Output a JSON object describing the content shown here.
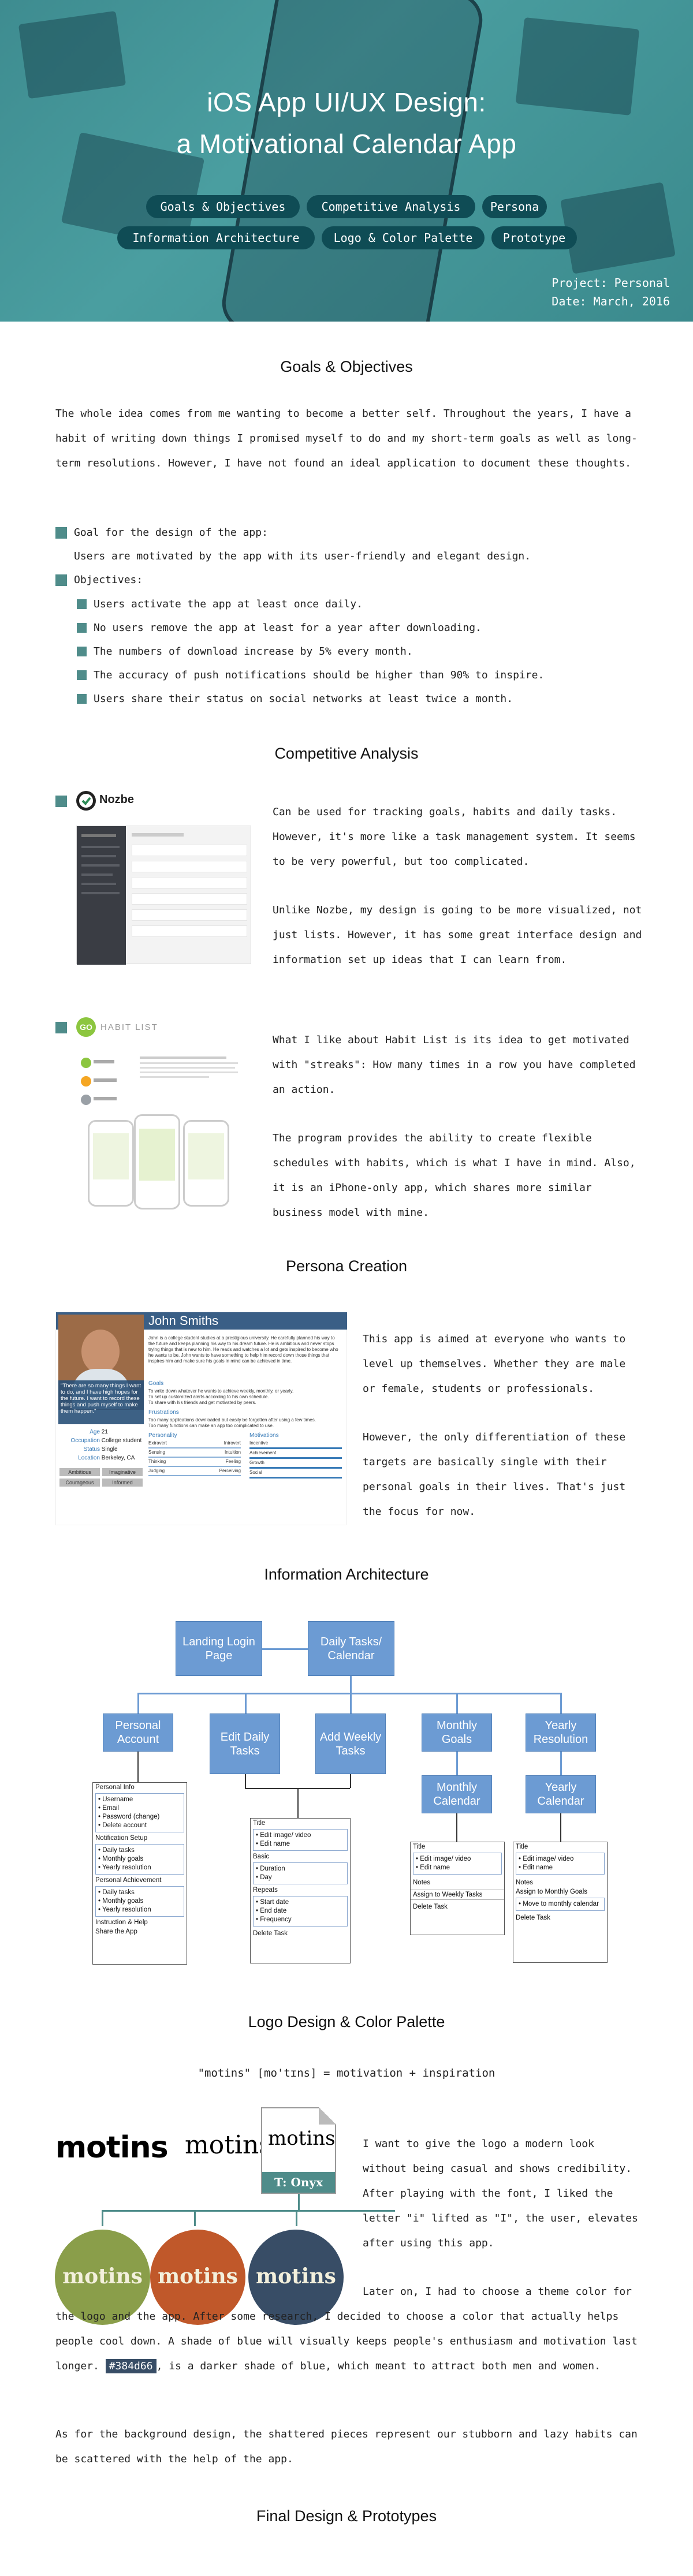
{
  "hero": {
    "title_line1": "iOS App UI/UX Design:",
    "title_line2": "a Motivational Calendar App",
    "nav": [
      "Goals & Objectives",
      "Competitive Analysis",
      "Persona",
      "Information Architecture",
      "Logo & Color Palette",
      "Prototype"
    ],
    "project": "Project: Personal",
    "date": "Date: March, 2016"
  },
  "goals": {
    "title": "Goals & Objectives",
    "intro": "The whole idea comes from me wanting to become a better self. Throughout the years, I have a habit of writing down things I promised myself to do and my short-term goals as well as long-term resolutions. However, I have not found an ideal application to document these thoughts.",
    "goal_heading": "Goal for the design of the app:",
    "goal_text": "Users are motivated by the app with its user-friendly and elegant design.",
    "objectives_heading": "Objectives:",
    "objectives": [
      "Users activate the app at least once daily.",
      "No users remove the app at least for a year after downloading.",
      "The numbers of download increase by 5% every month.",
      "The accuracy of push notifications should be higher than 90% to inspire.",
      "Users share their status on social networks at least twice a month."
    ]
  },
  "competitive": {
    "title": "Competitive Analysis",
    "nozbe_name": "Nozbe",
    "nozbe_p1": "Can be used for tracking goals, habits and daily tasks. However, it's more like a task management system. It seems to be very powerful, but too complicated.",
    "nozbe_p2": "Unlike Nozbe, my design is going to be more visualized, not just lists. However, it has some great interface design and information set up ideas that I can learn from.",
    "habit_badge": "GO",
    "habit_name": "HABIT LIST",
    "habit_p1": "What I like about Habit List is its idea to get motivated with \"streaks\": How many times in a row you have completed an action.",
    "habit_p2": "The program provides the ability to create flexible schedules with habits, which is what I have in mind. Also, it is an iPhone-only app, which shares more similar business model with mine."
  },
  "persona": {
    "title": "Persona Creation",
    "name": "John Smiths",
    "quote": "\"There are so many things I want to do, and I have high hopes for the future. I want to record these things and push myself to make them happen.\"",
    "bio": "John is a college student studies at a prestigious university. He carefully planned his way to the future and keeps planning his way to his dream future. He is ambitious and never stops trying things that is new to him. He reads and watches a lot and gets inspired to become who he wants to be. John wants to have something to help him record down those things that inspires him and make sure his goals in mind can be achieved in time.",
    "goals_label": "Goals",
    "goals_items": [
      "To write down whatever he wants to achieve weekly, monthly, or yearly.",
      "To set up customized alerts according to his own schedule.",
      "To share with his friends and get motivated by peers."
    ],
    "frustrations_label": "Frustrations",
    "frustrations_items": [
      "Too many applications downloaded but easily be forgotten after using a few times.",
      "Too many functions can make an app too complicated to use."
    ],
    "fields": [
      {
        "k": "Age",
        "v": "21"
      },
      {
        "k": "Occupation",
        "v": "College student"
      },
      {
        "k": "Status",
        "v": "Single"
      },
      {
        "k": "Location",
        "v": "Berkeley, CA"
      }
    ],
    "tags": [
      "Ambitious",
      "Imaginative",
      "Courageous",
      "Informed"
    ],
    "personality_label": "Personality",
    "personality_rows": [
      [
        "Extravert",
        "Introvert"
      ],
      [
        "Sensing",
        "Intuition"
      ],
      [
        "Thinking",
        "Feeling"
      ],
      [
        "Judging",
        "Perceiving"
      ]
    ],
    "motivations_label": "Motivations",
    "motivations_rows": [
      "Incentive",
      "Achievement",
      "Growth",
      "Social"
    ],
    "p1": "This app is aimed at everyone who wants to level up themselves. Whether they are male or female, students or professionals.",
    "p2": "However, the only differentiation of these targets are basically single with their personal goals in their lives. That's just the focus for now."
  },
  "ia": {
    "title": "Information Architecture",
    "landing": "Landing Login Page",
    "daily_cal": "Daily Tasks/ Calendar",
    "personal": "Personal Account",
    "edit_daily": "Edit Daily Tasks",
    "add_weekly": "Add Weekly Tasks",
    "monthly_goals": "Monthly Goals",
    "yearly_res": "Yearly Resolution",
    "monthly_cal": "Monthly Calendar",
    "yearly_cal": "Yearly Calendar",
    "personal_info": "Personal Info",
    "personal_info_items": [
      "Username",
      "Email",
      "Password (change)",
      "Delete account"
    ],
    "notif": "Notification Setup",
    "notif_items": [
      "Daily tasks",
      "Monthly goals",
      "Yearly resolution"
    ],
    "achievement": "Personal Achievement",
    "achievement_items": [
      "Daily tasks",
      "Monthly goals",
      "Yearly resolution"
    ],
    "instruction": "Instruction & Help",
    "share": "Share the App",
    "title_label": "Title",
    "title_items": [
      "Edit image/ video",
      "Edit name"
    ],
    "basic": "Basic",
    "basic_items": [
      "Duration",
      "Day"
    ],
    "repeats": "Repeats",
    "repeats_items": [
      "Start date",
      "End date",
      "Frequency"
    ],
    "delete_task": "Delete Task",
    "notes": "Notes",
    "assign_weekly": "Assign to Weekly Tasks",
    "assign_monthly": "Assign to Monthly Goals",
    "move_monthly": "Move to monthly calendar"
  },
  "logo": {
    "title": "Logo Design & Color Palette",
    "etym": "\"motins\" [mo'tɪns] = motivation + inspiration",
    "wordmark": "motins",
    "font_tag": "T: Onyx",
    "p1": "I want to give the logo a modern look without being casual and shows credibility. After playing with the font, I liked the letter \"i\" lifted as \"I\", the user, elevates after using this app.",
    "p2a": "Later on, I had to choose a theme color for the logo and the app. After some research, I decided to choose a color that actually helps people cool down. A shade of blue will visually keeps people's enthusiasm and motivation last longer.",
    "color_hex": "#384d66",
    "p2b": ", is a darker shade of blue, which meant to attract both men and women.",
    "p3": "As for the background design, the shattered pieces represent our stubborn and lazy habits can be scattered with the help of the app.",
    "colors": {
      "green": "#8a9e4a",
      "orange": "#c0582a",
      "blue": "#384d66",
      "teal": "#4f8c8a"
    }
  },
  "final": {
    "title": "Final Design & Prototypes"
  }
}
